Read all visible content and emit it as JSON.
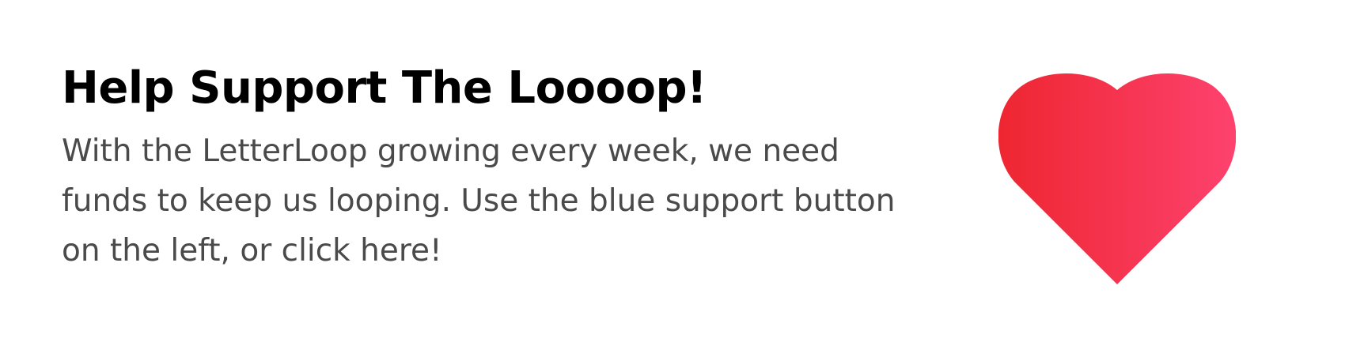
{
  "banner": {
    "title": "Help Support The Loooop!",
    "body": "With the LetterLoop growing every week, we need funds to keep us looping. Use the blue support button on the left, or click here!",
    "heart_icon": "heart-icon",
    "colors": {
      "heart_start": "#ee2631",
      "heart_end": "#fd426e",
      "title": "#000000",
      "body": "#4a4a4a",
      "background": "#ffffff"
    }
  }
}
